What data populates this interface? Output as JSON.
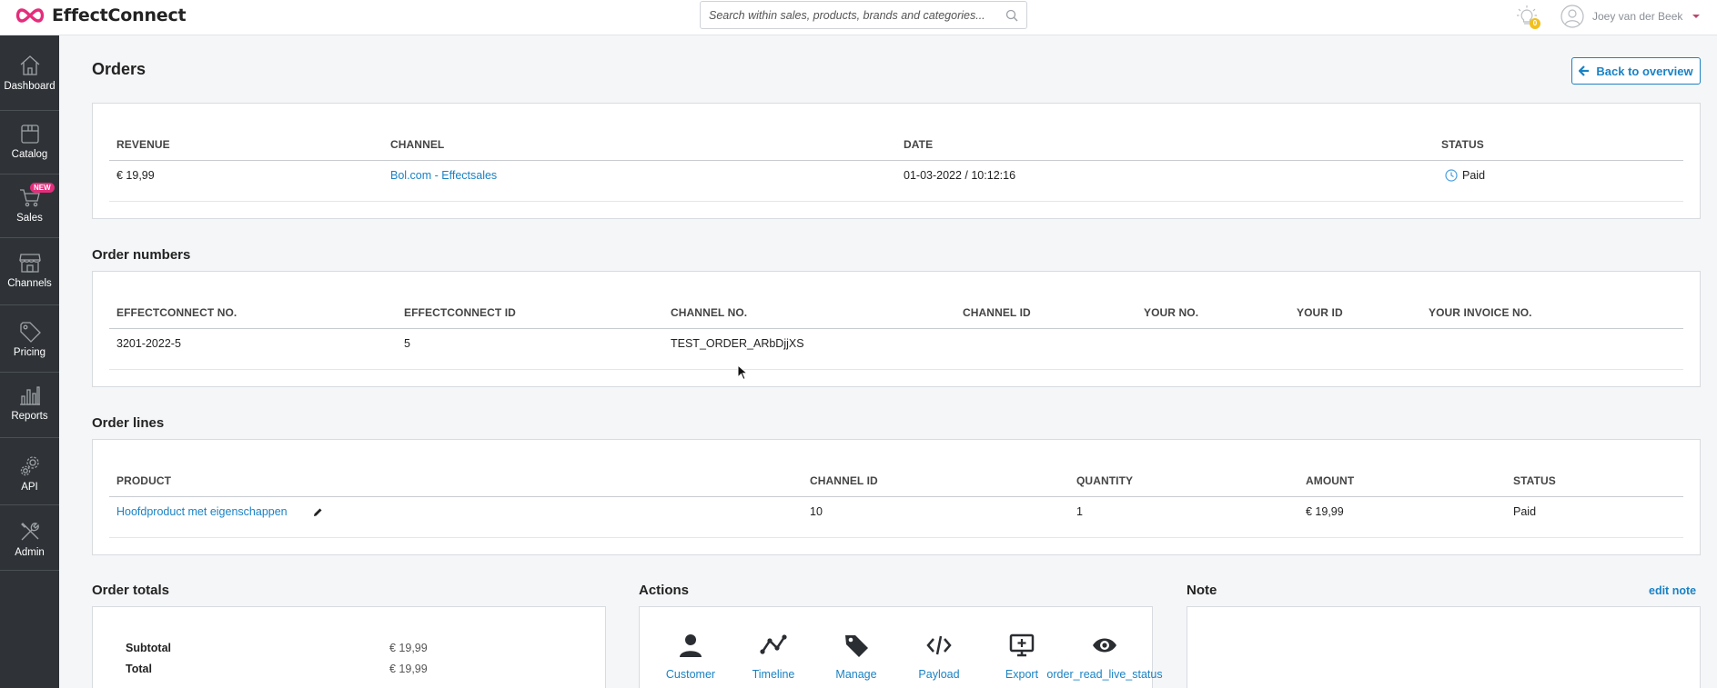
{
  "app": {
    "brand": "EffectConnect",
    "brand_color": "#e42d7b"
  },
  "search": {
    "placeholder": "Search within sales, products, brands and categories..."
  },
  "header": {
    "notifications_count": "0",
    "user_name": "Joey van der Beek"
  },
  "sidebar": {
    "items": [
      {
        "label": "Dashboard",
        "icon": "house-icon"
      },
      {
        "label": "Catalog",
        "icon": "catalog-box-icon"
      },
      {
        "label": "Sales",
        "icon": "cart-icon",
        "badge": "NEW"
      },
      {
        "label": "Channels",
        "icon": "storefront-icon"
      },
      {
        "label": "Pricing",
        "icon": "price-tag-icon"
      },
      {
        "label": "Reports",
        "icon": "bar-chart-icon"
      },
      {
        "label": "API",
        "icon": "gears-icon"
      },
      {
        "label": "Admin",
        "icon": "tools-icon"
      }
    ]
  },
  "page": {
    "title": "Orders",
    "back_label": "Back to overview"
  },
  "summary": {
    "headers": [
      "REVENUE",
      "CHANNEL",
      "DATE",
      "STATUS"
    ],
    "revenue": "€ 19,99",
    "channel": "Bol.com - Effectsales",
    "date": "01-03-2022 / 10:12:16",
    "status": "Paid"
  },
  "order_numbers": {
    "title": "Order numbers",
    "headers": [
      "EFFECTCONNECT NO.",
      "EFFECTCONNECT ID",
      "CHANNEL NO.",
      "CHANNEL ID",
      "YOUR NO.",
      "YOUR ID",
      "YOUR INVOICE NO."
    ],
    "row": [
      "3201-2022-5",
      "5",
      "TEST_ORDER_ARbDjjXS",
      "",
      "",
      "",
      ""
    ]
  },
  "order_lines": {
    "title": "Order lines",
    "headers": [
      "PRODUCT",
      "CHANNEL ID",
      "QUANTITY",
      "AMOUNT",
      "STATUS"
    ],
    "row": {
      "product": "Hoofdproduct met eigenschappen",
      "channel_id": "10",
      "quantity": "1",
      "amount": "€ 19,99",
      "status": "Paid"
    }
  },
  "order_totals": {
    "title": "Order totals",
    "rows": [
      {
        "label": "Subtotal",
        "value": "€ 19,99"
      },
      {
        "label": "Total",
        "value": "€ 19,99"
      }
    ]
  },
  "actions": {
    "title": "Actions",
    "items": [
      {
        "label": "Customer",
        "icon": "person-icon"
      },
      {
        "label": "Timeline",
        "icon": "timeline-icon"
      },
      {
        "label": "Manage",
        "icon": "tag-icon"
      },
      {
        "label": "Payload",
        "icon": "code-icon"
      },
      {
        "label": "Export",
        "icon": "monitor-export-icon"
      },
      {
        "label": "order_read_live_status",
        "icon": "eye-icon"
      }
    ]
  },
  "note": {
    "title": "Note",
    "edit_label": "edit note"
  }
}
